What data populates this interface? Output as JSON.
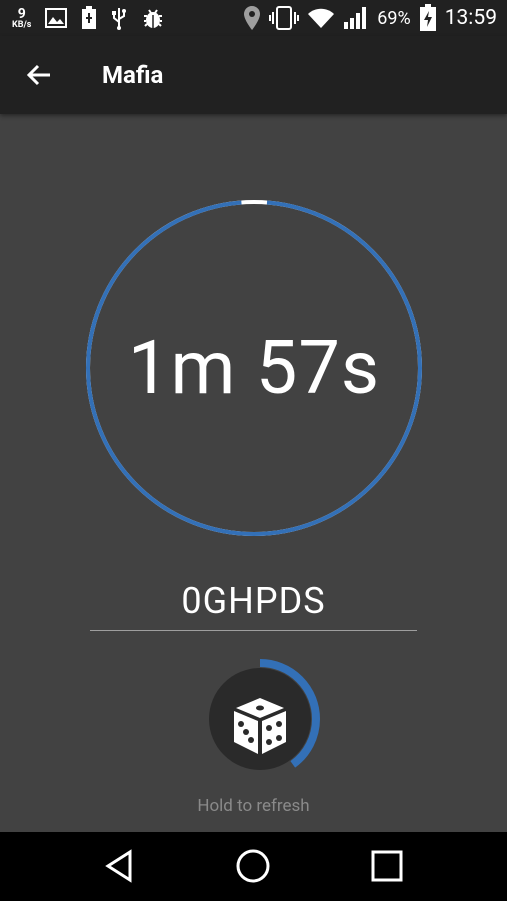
{
  "status_bar": {
    "speed_value": "9",
    "speed_unit": "KB/s",
    "battery_percent": "69%",
    "time": "13:59",
    "icons": [
      "image-icon",
      "battery-saver-icon",
      "usb-icon",
      "debug-icon",
      "location-icon",
      "vibrate-icon",
      "wifi-icon",
      "signal-icon",
      "battery-charging-icon"
    ]
  },
  "app_bar": {
    "title": "Mafia",
    "back_icon": "arrow-back-icon"
  },
  "timer": {
    "text": "1m 57s",
    "progress_fraction": 0.975,
    "ring_color": "#3370b7",
    "remaining_color": "#ffffff"
  },
  "code": {
    "value": "0GHPDS"
  },
  "refresh": {
    "icon": "dice-icon",
    "progress_fraction": 0.4,
    "hint": "Hold to refresh"
  },
  "nav_bar": {
    "icons": [
      "back-triangle-icon",
      "home-circle-icon",
      "recents-square-icon"
    ]
  }
}
